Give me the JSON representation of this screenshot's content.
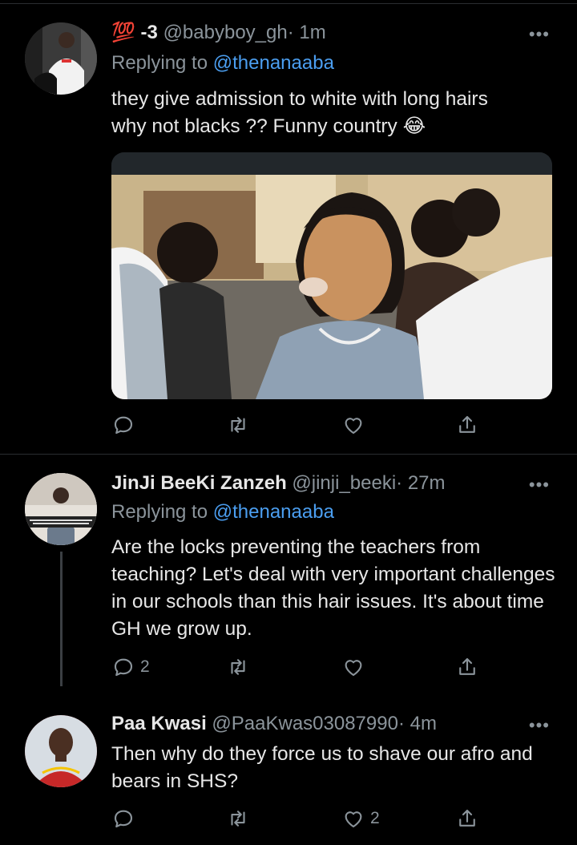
{
  "tweets": [
    {
      "name": "💯 -3",
      "handle": "@babyboy_gh",
      "time": "· 1m",
      "replying_label": "Replying to",
      "replying_to": "@thenanaaba",
      "text_line1": "they give admission to white with long hairs",
      "text_line2": "why not blacks ?? Funny country 😂",
      "more": "•••",
      "reply_count": "",
      "retweet_count": "",
      "like_count": ""
    },
    {
      "name": "JinJi BeeKi Zanzeh",
      "handle": "@jinji_beeki",
      "time": "· 27m",
      "replying_label": "Replying to",
      "replying_to": "@thenanaaba",
      "text": "Are the locks preventing the teachers from teaching?  Let's deal with very important challenges in our schools than this hair issues. It's about time GH we grow up.",
      "more": "•••",
      "reply_count": "2",
      "retweet_count": "",
      "like_count": ""
    },
    {
      "name": "Paa Kwasi",
      "handle": "@PaaKwas03087990",
      "time": "· 4m",
      "text": "Then why do they force us to shave our afro and bears in SHS?",
      "more": "•••",
      "reply_count": "",
      "retweet_count": "",
      "like_count": "2"
    }
  ],
  "colors": {
    "background": "#000000",
    "text": "#e7e7e7",
    "muted": "#8b949b",
    "link": "#4b9ef0"
  },
  "icons": [
    "reply-icon",
    "retweet-icon",
    "like-icon",
    "share-icon",
    "more-icon"
  ]
}
